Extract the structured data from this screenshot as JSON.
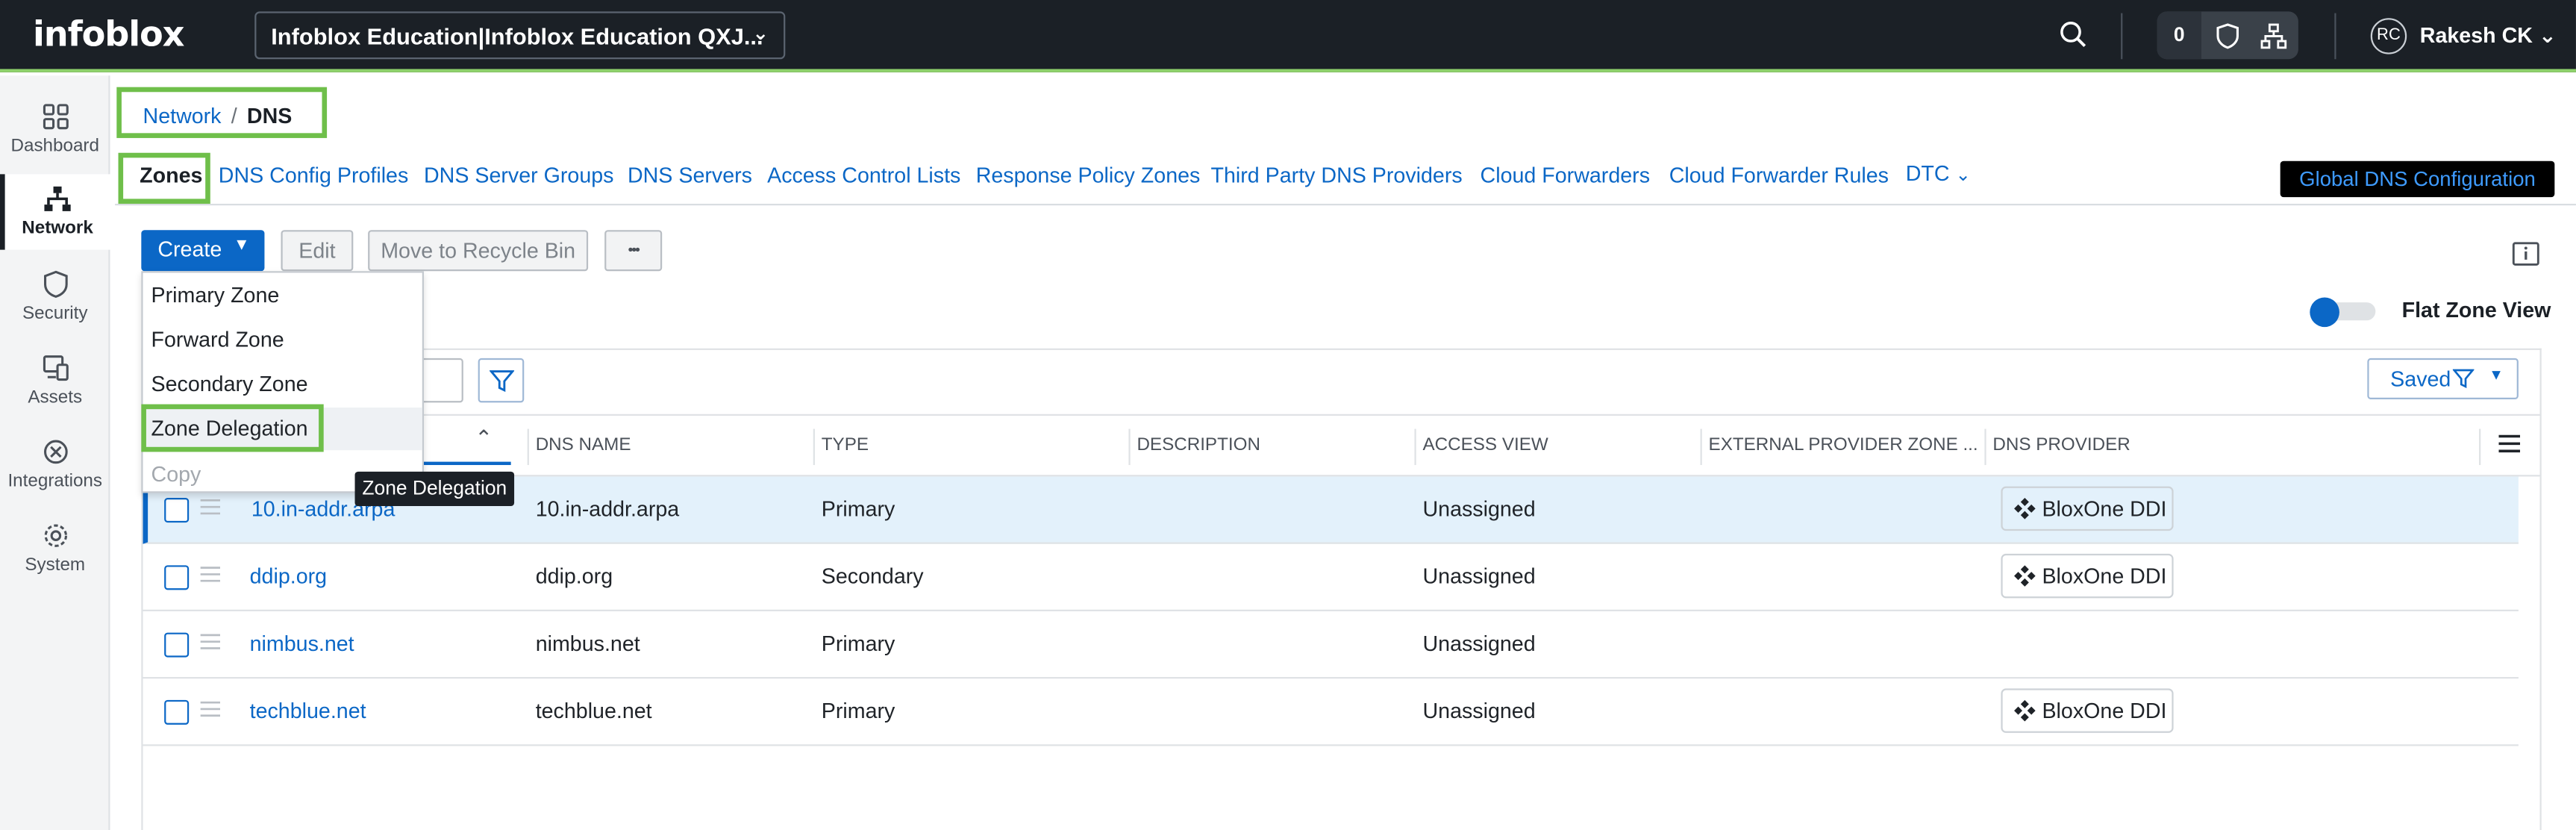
{
  "brand": {
    "logo_text": "infoblox",
    "accent_color": "#8ed16b",
    "link_color": "#0b67c6"
  },
  "header": {
    "account_selector": "Infoblox Education|Infoblox Education QXJ...",
    "notification_count": "0",
    "avatar_initials": "RC",
    "user_name": "Rakesh CK"
  },
  "sidebar": {
    "items": [
      {
        "label": "Dashboard",
        "icon": "dashboard-icon"
      },
      {
        "label": "Network",
        "icon": "network-icon",
        "active": true
      },
      {
        "label": "Security",
        "icon": "shield-icon"
      },
      {
        "label": "Assets",
        "icon": "assets-icon"
      },
      {
        "label": "Integrations",
        "icon": "integrations-icon"
      },
      {
        "label": "System",
        "icon": "gear-icon"
      }
    ]
  },
  "breadcrumb": {
    "parent": "Network",
    "separator": "/",
    "current": "DNS"
  },
  "tabs": [
    {
      "label": "Zones",
      "active": true
    },
    {
      "label": "DNS Config Profiles"
    },
    {
      "label": "DNS Server Groups"
    },
    {
      "label": "DNS Servers"
    },
    {
      "label": "Access Control Lists"
    },
    {
      "label": "Response Policy Zones"
    },
    {
      "label": "Third Party DNS Providers"
    },
    {
      "label": "Cloud Forwarders"
    },
    {
      "label": "Cloud Forwarder Rules"
    },
    {
      "label": "DTC"
    }
  ],
  "global_dns_button": "Global DNS Configuration",
  "toolbar": {
    "create_label": "Create",
    "edit_label": "Edit",
    "recycle_label": "Move to Recycle Bin",
    "more_label": "•••"
  },
  "create_menu": {
    "items": [
      "Primary Zone",
      "Forward Zone",
      "Secondary Zone",
      "Zone Delegation",
      "Copy"
    ],
    "hovered": "Zone Delegation",
    "disabled": [
      "Copy"
    ]
  },
  "tooltip": "Zone Delegation",
  "flat_zone_view": {
    "label": "Flat Zone View",
    "on": true
  },
  "saved_label": "Saved",
  "table": {
    "columns": [
      "DNS NAME",
      "TYPE",
      "DESCRIPTION",
      "ACCESS VIEW",
      "EXTERNAL PROVIDER ZONE ...",
      "DNS PROVIDER"
    ],
    "rows": [
      {
        "name": "10.in-addr.arpa",
        "dns_name": "10.in-addr.arpa",
        "type": "Primary",
        "description": "",
        "access_view": "Unassigned",
        "external": "",
        "provider": "BloxOne DDI",
        "selected": true
      },
      {
        "name": "ddip.org",
        "dns_name": "ddip.org",
        "type": "Secondary",
        "description": "",
        "access_view": "Unassigned",
        "external": "",
        "provider": "BloxOne DDI"
      },
      {
        "name": "nimbus.net",
        "dns_name": "nimbus.net",
        "type": "Primary",
        "description": "",
        "access_view": "Unassigned",
        "external": "",
        "provider": ""
      },
      {
        "name": "techblue.net",
        "dns_name": "techblue.net",
        "type": "Primary",
        "description": "",
        "access_view": "Unassigned",
        "external": "",
        "provider": "BloxOne DDI"
      }
    ]
  }
}
